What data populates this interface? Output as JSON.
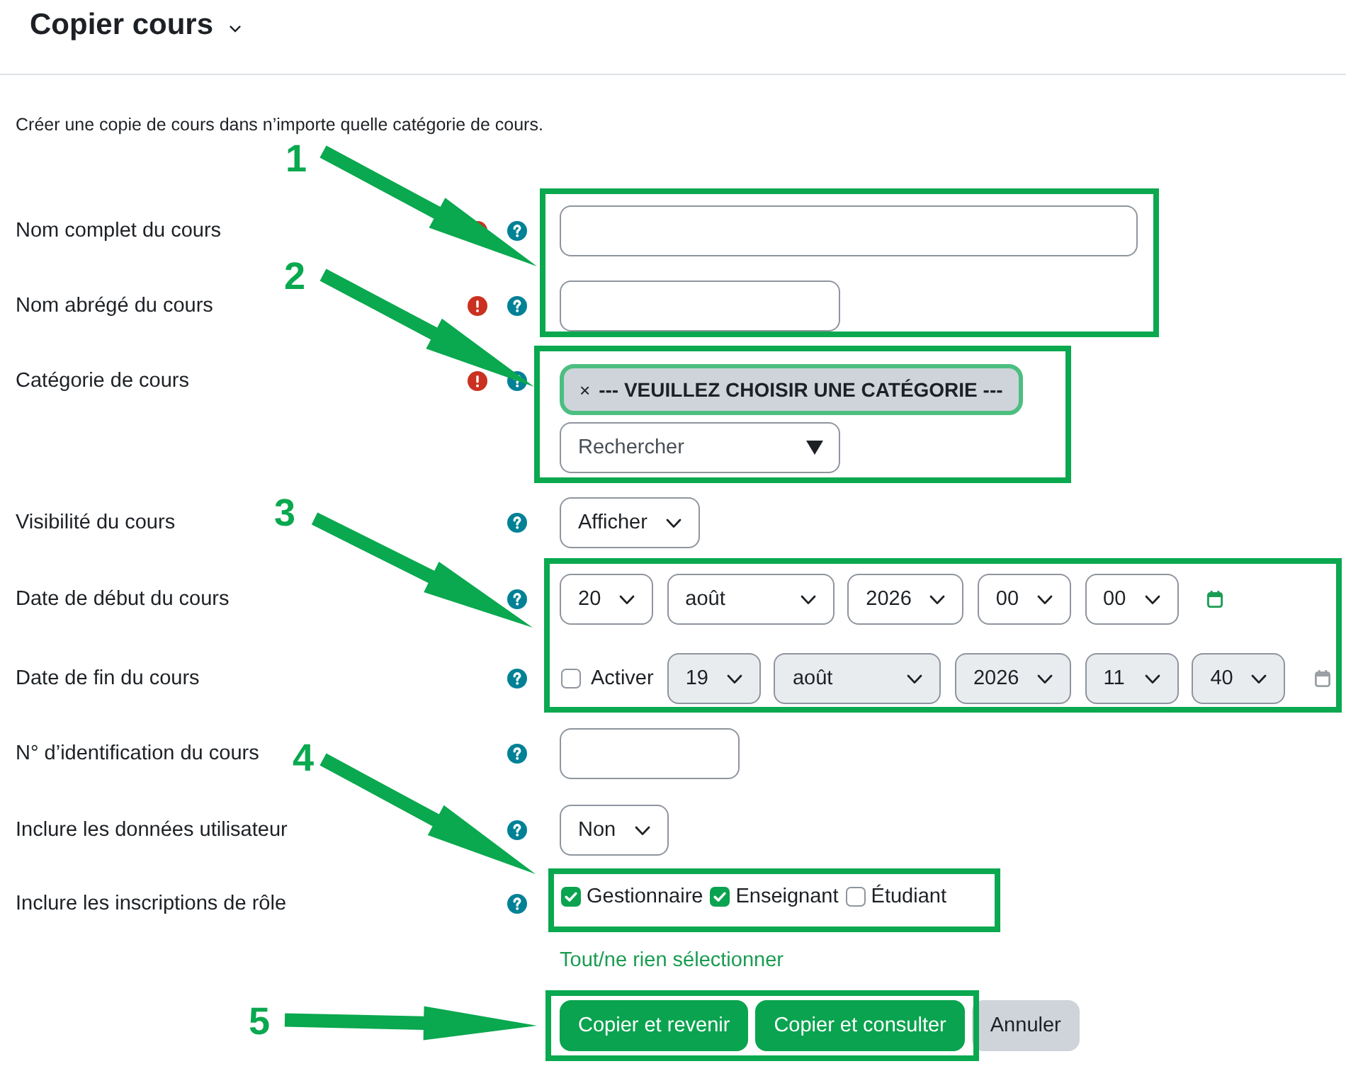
{
  "header": {
    "title": "Copier cours"
  },
  "intro": "Créer une copie de cours dans n’importe quelle catégorie de cours.",
  "fields": [
    {
      "kind": "text",
      "label": "Nom complet du cours",
      "required": true,
      "help": true
    },
    {
      "kind": "text",
      "label": "Nom abrégé du cours",
      "required": true,
      "help": true
    },
    {
      "kind": "autocomplete",
      "label": "Catégorie de cours",
      "required": true,
      "help": true,
      "selection": {
        "remove": "×",
        "label": "--- VEUILLEZ CHOISIR UNE CATÉGORIE ---",
        "focused": true
      },
      "search": {
        "placeholder": "Rechercher"
      }
    },
    {
      "kind": "select",
      "label": "Visibilité du cours",
      "required": false,
      "help": true,
      "value": "Afficher"
    },
    {
      "kind": "date",
      "label": "Date de début du cours",
      "required": false,
      "help": true,
      "disabled": false,
      "parts": [
        "20",
        "août",
        "2026",
        "00",
        "00"
      ]
    },
    {
      "kind": "date",
      "label": "Date de fin du cours",
      "required": false,
      "help": true,
      "disabled": true,
      "toggle": {
        "label": "Activer",
        "checked": false
      },
      "parts": [
        "19",
        "août",
        "2026",
        "11",
        "40"
      ]
    },
    {
      "kind": "text",
      "label": "N° d’identification du cours",
      "required": false,
      "help": true
    },
    {
      "kind": "select",
      "label": "Inclure les données utilisateur",
      "required": false,
      "help": true,
      "value": "Non"
    },
    {
      "kind": "checkboxes",
      "label": "Inclure les inscriptions de rôle",
      "required": false,
      "help": true,
      "options": [
        {
          "label": "Gestionnaire",
          "checked": true
        },
        {
          "label": "Enseignant",
          "checked": true
        },
        {
          "label": "Étudiant",
          "checked": false
        }
      ],
      "link": "Tout/ne rien sélectionner"
    }
  ],
  "buttons": [
    {
      "label": "Copier et revenir",
      "kind": "primary"
    },
    {
      "label": "Copier et consulter",
      "kind": "primary"
    },
    {
      "label": "Annuler",
      "kind": "secondary"
    }
  ],
  "annotations": [
    {
      "number": "1"
    },
    {
      "number": "2"
    },
    {
      "number": "3"
    },
    {
      "number": "4"
    },
    {
      "number": "5"
    }
  ]
}
